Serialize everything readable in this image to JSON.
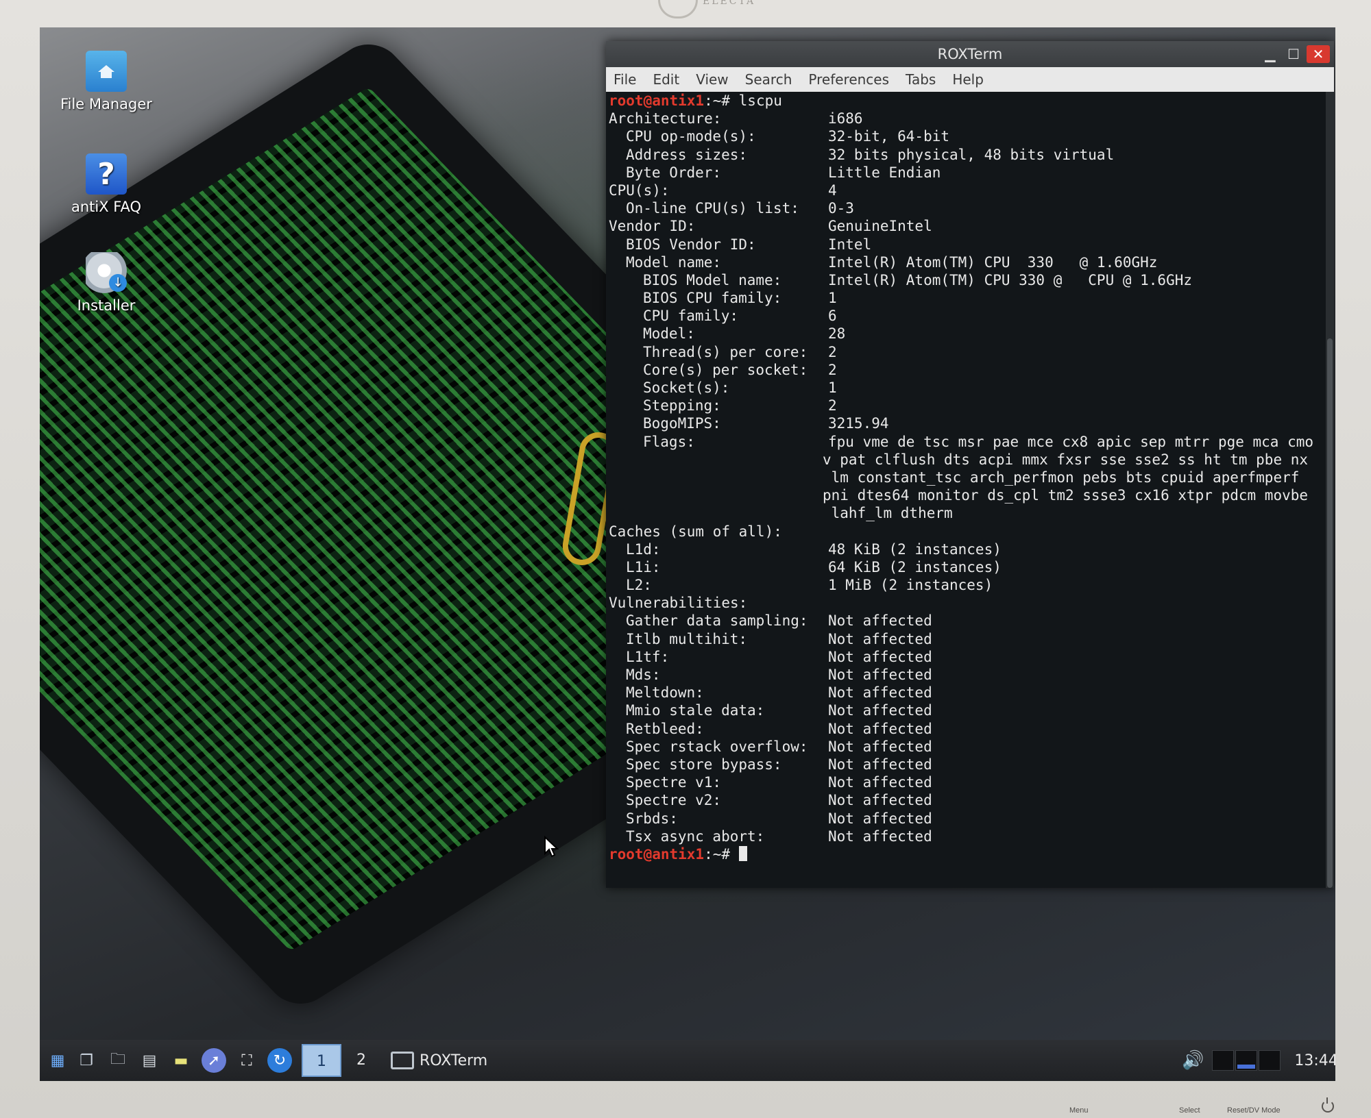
{
  "monitor": {
    "brand": "ELECTA",
    "buttons": [
      "Menu",
      "Select",
      "Reset/DV Mode"
    ]
  },
  "desktop": {
    "icons": [
      {
        "label": "File Manager",
        "icon": "folder-home-icon"
      },
      {
        "label": "antiX FAQ",
        "icon": "question-icon"
      },
      {
        "label": "Installer",
        "icon": "installer-disc-icon"
      }
    ]
  },
  "window": {
    "title": "ROXTerm",
    "menu": [
      "File",
      "Edit",
      "View",
      "Search",
      "Preferences",
      "Tabs",
      "Help"
    ]
  },
  "terminal": {
    "prompt_user": "root@antix1",
    "prompt_suffix": ":~# ",
    "command": "lscpu",
    "lines": [
      {
        "indent": 0,
        "key": "Architecture:",
        "value": "i686"
      },
      {
        "indent": 1,
        "key": "CPU op-mode(s):",
        "value": "32-bit, 64-bit"
      },
      {
        "indent": 1,
        "key": "Address sizes:",
        "value": "32 bits physical, 48 bits virtual"
      },
      {
        "indent": 1,
        "key": "Byte Order:",
        "value": "Little Endian"
      },
      {
        "indent": 0,
        "key": "CPU(s):",
        "value": "4"
      },
      {
        "indent": 1,
        "key": "On-line CPU(s) list:",
        "value": "0-3"
      },
      {
        "indent": 0,
        "key": "Vendor ID:",
        "value": "GenuineIntel"
      },
      {
        "indent": 1,
        "key": "BIOS Vendor ID:",
        "value": "Intel"
      },
      {
        "indent": 1,
        "key": "Model name:",
        "value": "Intel(R) Atom(TM) CPU  330   @ 1.60GHz"
      },
      {
        "indent": 2,
        "key": "BIOS Model name:",
        "value": "Intel(R) Atom(TM) CPU 330 @   CPU @ 1.6GHz"
      },
      {
        "indent": 2,
        "key": "BIOS CPU family:",
        "value": "1"
      },
      {
        "indent": 2,
        "key": "CPU family:",
        "value": "6"
      },
      {
        "indent": 2,
        "key": "Model:",
        "value": "28"
      },
      {
        "indent": 2,
        "key": "Thread(s) per core:",
        "value": "2"
      },
      {
        "indent": 2,
        "key": "Core(s) per socket:",
        "value": "2"
      },
      {
        "indent": 2,
        "key": "Socket(s):",
        "value": "1"
      },
      {
        "indent": 2,
        "key": "Stepping:",
        "value": "2"
      },
      {
        "indent": 2,
        "key": "BogoMIPS:",
        "value": "3215.94"
      },
      {
        "indent": 2,
        "key": "Flags:",
        "value": "fpu vme de tsc msr pae mce cx8 apic sep mtrr pge mca cmo"
      },
      {
        "indent": 0,
        "key": "",
        "value": "v pat clflush dts acpi mmx fxsr sse sse2 ss ht tm pbe nx"
      },
      {
        "indent": 0,
        "key": "",
        "value": " lm constant_tsc arch_perfmon pebs bts cpuid aperfmperf"
      },
      {
        "indent": 0,
        "key": "",
        "value": "pni dtes64 monitor ds_cpl tm2 ssse3 cx16 xtpr pdcm movbe"
      },
      {
        "indent": 0,
        "key": "",
        "value": " lahf_lm dtherm"
      },
      {
        "indent": 0,
        "key": "Caches (sum of all):",
        "value": ""
      },
      {
        "indent": 1,
        "key": "L1d:",
        "value": "48 KiB (2 instances)"
      },
      {
        "indent": 1,
        "key": "L1i:",
        "value": "64 KiB (2 instances)"
      },
      {
        "indent": 1,
        "key": "L2:",
        "value": "1 MiB (2 instances)"
      },
      {
        "indent": 0,
        "key": "Vulnerabilities:",
        "value": ""
      },
      {
        "indent": 1,
        "key": "Gather data sampling:",
        "value": "Not affected"
      },
      {
        "indent": 1,
        "key": "Itlb multihit:",
        "value": "Not affected"
      },
      {
        "indent": 1,
        "key": "L1tf:",
        "value": "Not affected"
      },
      {
        "indent": 1,
        "key": "Mds:",
        "value": "Not affected"
      },
      {
        "indent": 1,
        "key": "Meltdown:",
        "value": "Not affected"
      },
      {
        "indent": 1,
        "key": "Mmio stale data:",
        "value": "Not affected"
      },
      {
        "indent": 1,
        "key": "Retbleed:",
        "value": "Not affected"
      },
      {
        "indent": 1,
        "key": "Spec rstack overflow:",
        "value": "Not affected"
      },
      {
        "indent": 1,
        "key": "Spec store bypass:",
        "value": "Not affected"
      },
      {
        "indent": 1,
        "key": "Spectre v1:",
        "value": "Not affected"
      },
      {
        "indent": 1,
        "key": "Spectre v2:",
        "value": "Not affected"
      },
      {
        "indent": 1,
        "key": "Srbds:",
        "value": "Not affected"
      },
      {
        "indent": 1,
        "key": "Tsx async abort:",
        "value": "Not affected"
      }
    ]
  },
  "taskbar": {
    "launchers": [
      "apps-grid-icon",
      "windows-icon",
      "file-manager-icon",
      "text-editor-icon",
      "notes-icon",
      "browser-icon",
      "paint-bucket-icon",
      "updater-icon"
    ],
    "workspaces": [
      "1",
      "2"
    ],
    "active_workspace": "1",
    "task_label": "ROXTerm",
    "clock": "13:44"
  },
  "colors": {
    "prompt": "#e33a2d",
    "terminal_bg": "#121619",
    "terminal_fg": "#e9e9e9",
    "close_button": "#d8392f"
  }
}
